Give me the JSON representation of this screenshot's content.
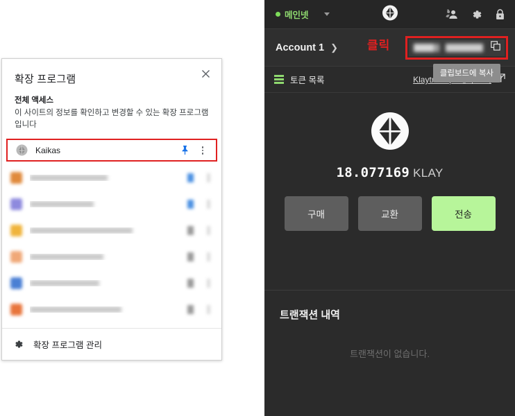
{
  "extensions_popup": {
    "title": "확장 프로그램",
    "close_icon": "close-icon",
    "access_section": {
      "heading": "전체 액세스",
      "description": "이 사이트의 정보를 확인하고 변경할 수 있는 확장 프로그램입니다"
    },
    "highlighted_item": {
      "name": "Kaikas",
      "pin_icon": "pin-icon",
      "pin_color": "#1a73e8",
      "menu_icon": "more-vertical-icon",
      "highlight_color": "#e02020"
    },
    "redacted_items": [
      {
        "icon_color": "#e08a3c",
        "name_width": 112,
        "pin_color": "#4a90e2"
      },
      {
        "icon_color": "#8e8ade",
        "name_width": 92,
        "pin_color": "#4a90e2"
      },
      {
        "icon_color": "#f0b43c",
        "name_width": 148,
        "pin_color": "#9a9a9a"
      },
      {
        "icon_color": "#f0a878",
        "name_width": 106,
        "pin_color": "#9a9a9a"
      },
      {
        "icon_color": "#4a7fd4",
        "name_width": 100,
        "pin_color": "#9a9a9a"
      },
      {
        "icon_color": "#e8753c",
        "name_width": 132,
        "pin_color": "#9a9a9a"
      }
    ],
    "footer": {
      "gear_icon": "gear-icon",
      "label": "확장 프로그램 관리"
    }
  },
  "wallet": {
    "topbar": {
      "network_label": "메인넷",
      "network_status_color": "#7ddc5a",
      "caret_icon": "chevron-down-icon",
      "brand_icon": "kaikas-logo-icon",
      "icons": [
        {
          "name": "account-switch-icon"
        },
        {
          "name": "gear-icon"
        },
        {
          "name": "lock-icon"
        }
      ]
    },
    "account": {
      "name": "Account 1",
      "chevron_icon": "chevron-right-icon",
      "annotation": "클릭",
      "annotation_color": "#e02020",
      "address_redacted": true,
      "copy_icon": "copy-icon",
      "tooltip": "클립보드에 복사"
    },
    "token_bar": {
      "menu_icon": "hamburger-icon",
      "label": "토큰 목록",
      "link_text": "Klaytnscope에서 보기",
      "link_icon": "external-link-icon"
    },
    "balance": {
      "logo_icon": "kaikas-logo-icon",
      "amount": "18.077169",
      "unit": "KLAY"
    },
    "actions": [
      {
        "label": "구매",
        "style": "secondary"
      },
      {
        "label": "교환",
        "style": "secondary"
      },
      {
        "label": "전송",
        "style": "primary",
        "color": "#b7f59a"
      }
    ],
    "transactions": {
      "title": "트랜잭션 내역",
      "empty_text": "트랜잭션이 없습니다."
    }
  }
}
